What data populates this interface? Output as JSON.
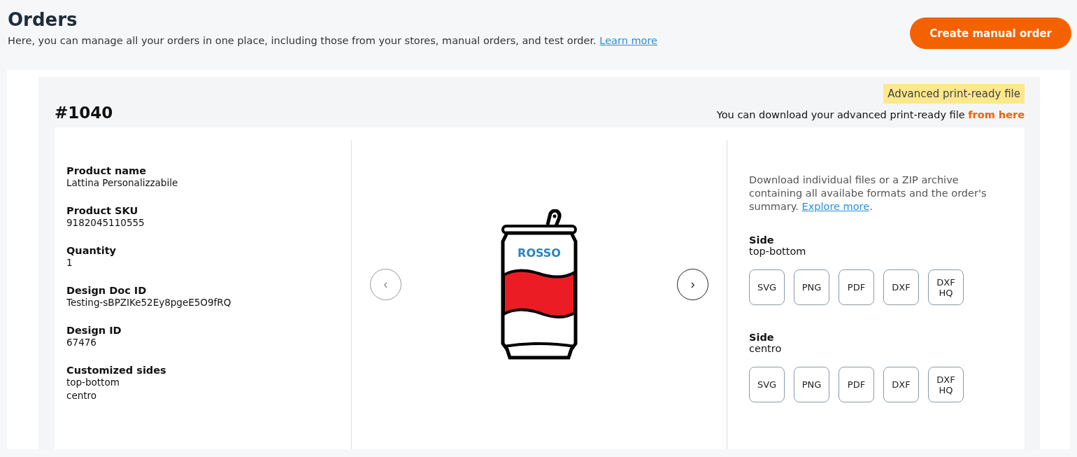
{
  "header": {
    "title": "Orders",
    "description": "Here, you can manage all your orders in one place, including those from your stores, manual orders, and test order.",
    "learn_more_link": "Learn more",
    "create_button": "Create manual order"
  },
  "order": {
    "number": "#1040",
    "badge": "Advanced print-ready file",
    "download_text": "You can download your advanced print-ready file",
    "download_link": "from here",
    "details": [
      {
        "label": "Product name",
        "values": [
          "Lattina Personalizzabile"
        ]
      },
      {
        "label": "Product SKU",
        "values": [
          "9182045110555"
        ]
      },
      {
        "label": "Quantity",
        "values": [
          "1"
        ]
      },
      {
        "label": "Design Doc ID",
        "values": [
          "Testing-sBPZIKe52Ey8pgeE5O9fRQ"
        ]
      },
      {
        "label": "Design ID",
        "values": [
          "67476"
        ]
      },
      {
        "label": "Customized sides",
        "values": [
          "top-bottom",
          "centro"
        ]
      }
    ],
    "preview": {
      "can_label": "ROSSO",
      "prev_button": {
        "label": "‹",
        "disabled": true
      },
      "next_button": {
        "label": "›",
        "disabled": false
      }
    },
    "downloads": {
      "intro": "Download individual files or a ZIP archive containing all availabe formats and the order's summary.",
      "explore_link": "Explore more",
      "intro_end": ".",
      "sides": [
        {
          "label": "Side",
          "name": "top-bottom",
          "formats": [
            "SVG",
            "PNG",
            "PDF",
            "DXF",
            "DXF HQ"
          ]
        },
        {
          "label": "Side",
          "name": "centro",
          "formats": [
            "SVG",
            "PNG",
            "PDF",
            "DXF",
            "DXF HQ"
          ]
        }
      ]
    }
  }
}
